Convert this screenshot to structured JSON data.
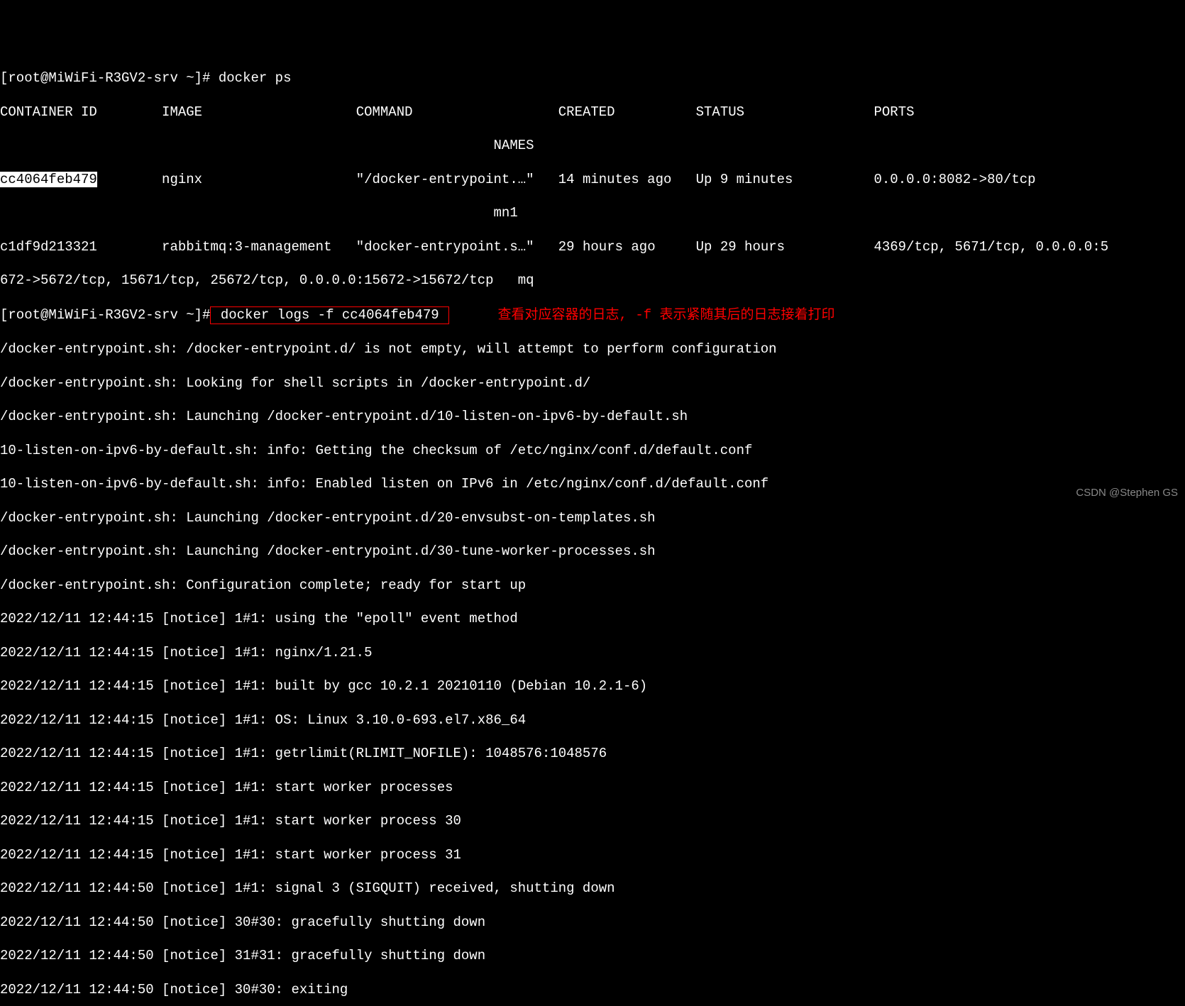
{
  "prompt1": "[root@MiWiFi-R3GV2-srv ~]# ",
  "cmd1": "docker ps",
  "headers": {
    "container_id": "CONTAINER ID",
    "image": "IMAGE",
    "command": "COMMAND",
    "created": "CREATED",
    "status": "STATUS",
    "ports": "PORTS",
    "names": "NAMES"
  },
  "row1": {
    "id": "cc4064feb479",
    "image": "nginx",
    "command": "\"/docker-entrypoint.…\"",
    "created": "14 minutes ago",
    "status": "Up 9 minutes",
    "ports": "0.0.0.0:8082->80/tcp",
    "names": "mn1"
  },
  "row2": {
    "id": "c1df9d213321",
    "image": "rabbitmq:3-management",
    "command": "\"docker-entrypoint.s…\"",
    "created": "29 hours ago",
    "status": "Up 29 hours",
    "ports_part1": "4369/tcp, 5671/tcp, 0.0.0.0:5",
    "ports_wrap": "672->5672/tcp, 15671/tcp, 25672/tcp, 0.0.0.0:15672->15672/tcp   mq"
  },
  "prompt2": "[root@MiWiFi-R3GV2-srv ~]#",
  "cmd2": " docker logs -f cc4064feb479 ",
  "annotation": "查看对应容器的日志, -f 表示紧随其后的日志接着打印",
  "logs": [
    "/docker-entrypoint.sh: /docker-entrypoint.d/ is not empty, will attempt to perform configuration",
    "/docker-entrypoint.sh: Looking for shell scripts in /docker-entrypoint.d/",
    "/docker-entrypoint.sh: Launching /docker-entrypoint.d/10-listen-on-ipv6-by-default.sh",
    "10-listen-on-ipv6-by-default.sh: info: Getting the checksum of /etc/nginx/conf.d/default.conf",
    "10-listen-on-ipv6-by-default.sh: info: Enabled listen on IPv6 in /etc/nginx/conf.d/default.conf",
    "/docker-entrypoint.sh: Launching /docker-entrypoint.d/20-envsubst-on-templates.sh",
    "/docker-entrypoint.sh: Launching /docker-entrypoint.d/30-tune-worker-processes.sh",
    "/docker-entrypoint.sh: Configuration complete; ready for start up",
    "2022/12/11 12:44:15 [notice] 1#1: using the \"epoll\" event method",
    "2022/12/11 12:44:15 [notice] 1#1: nginx/1.21.5",
    "2022/12/11 12:44:15 [notice] 1#1: built by gcc 10.2.1 20210110 (Debian 10.2.1-6)",
    "2022/12/11 12:44:15 [notice] 1#1: OS: Linux 3.10.0-693.el7.x86_64",
    "2022/12/11 12:44:15 [notice] 1#1: getrlimit(RLIMIT_NOFILE): 1048576:1048576",
    "2022/12/11 12:44:15 [notice] 1#1: start worker processes",
    "2022/12/11 12:44:15 [notice] 1#1: start worker process 30",
    "2022/12/11 12:44:15 [notice] 1#1: start worker process 31",
    "2022/12/11 12:44:50 [notice] 1#1: signal 3 (SIGQUIT) received, shutting down",
    "2022/12/11 12:44:50 [notice] 30#30: gracefully shutting down",
    "2022/12/11 12:44:50 [notice] 31#31: gracefully shutting down",
    "2022/12/11 12:44:50 [notice] 30#30: exiting"
  ],
  "watermark": "CSDN @Stephen GS"
}
